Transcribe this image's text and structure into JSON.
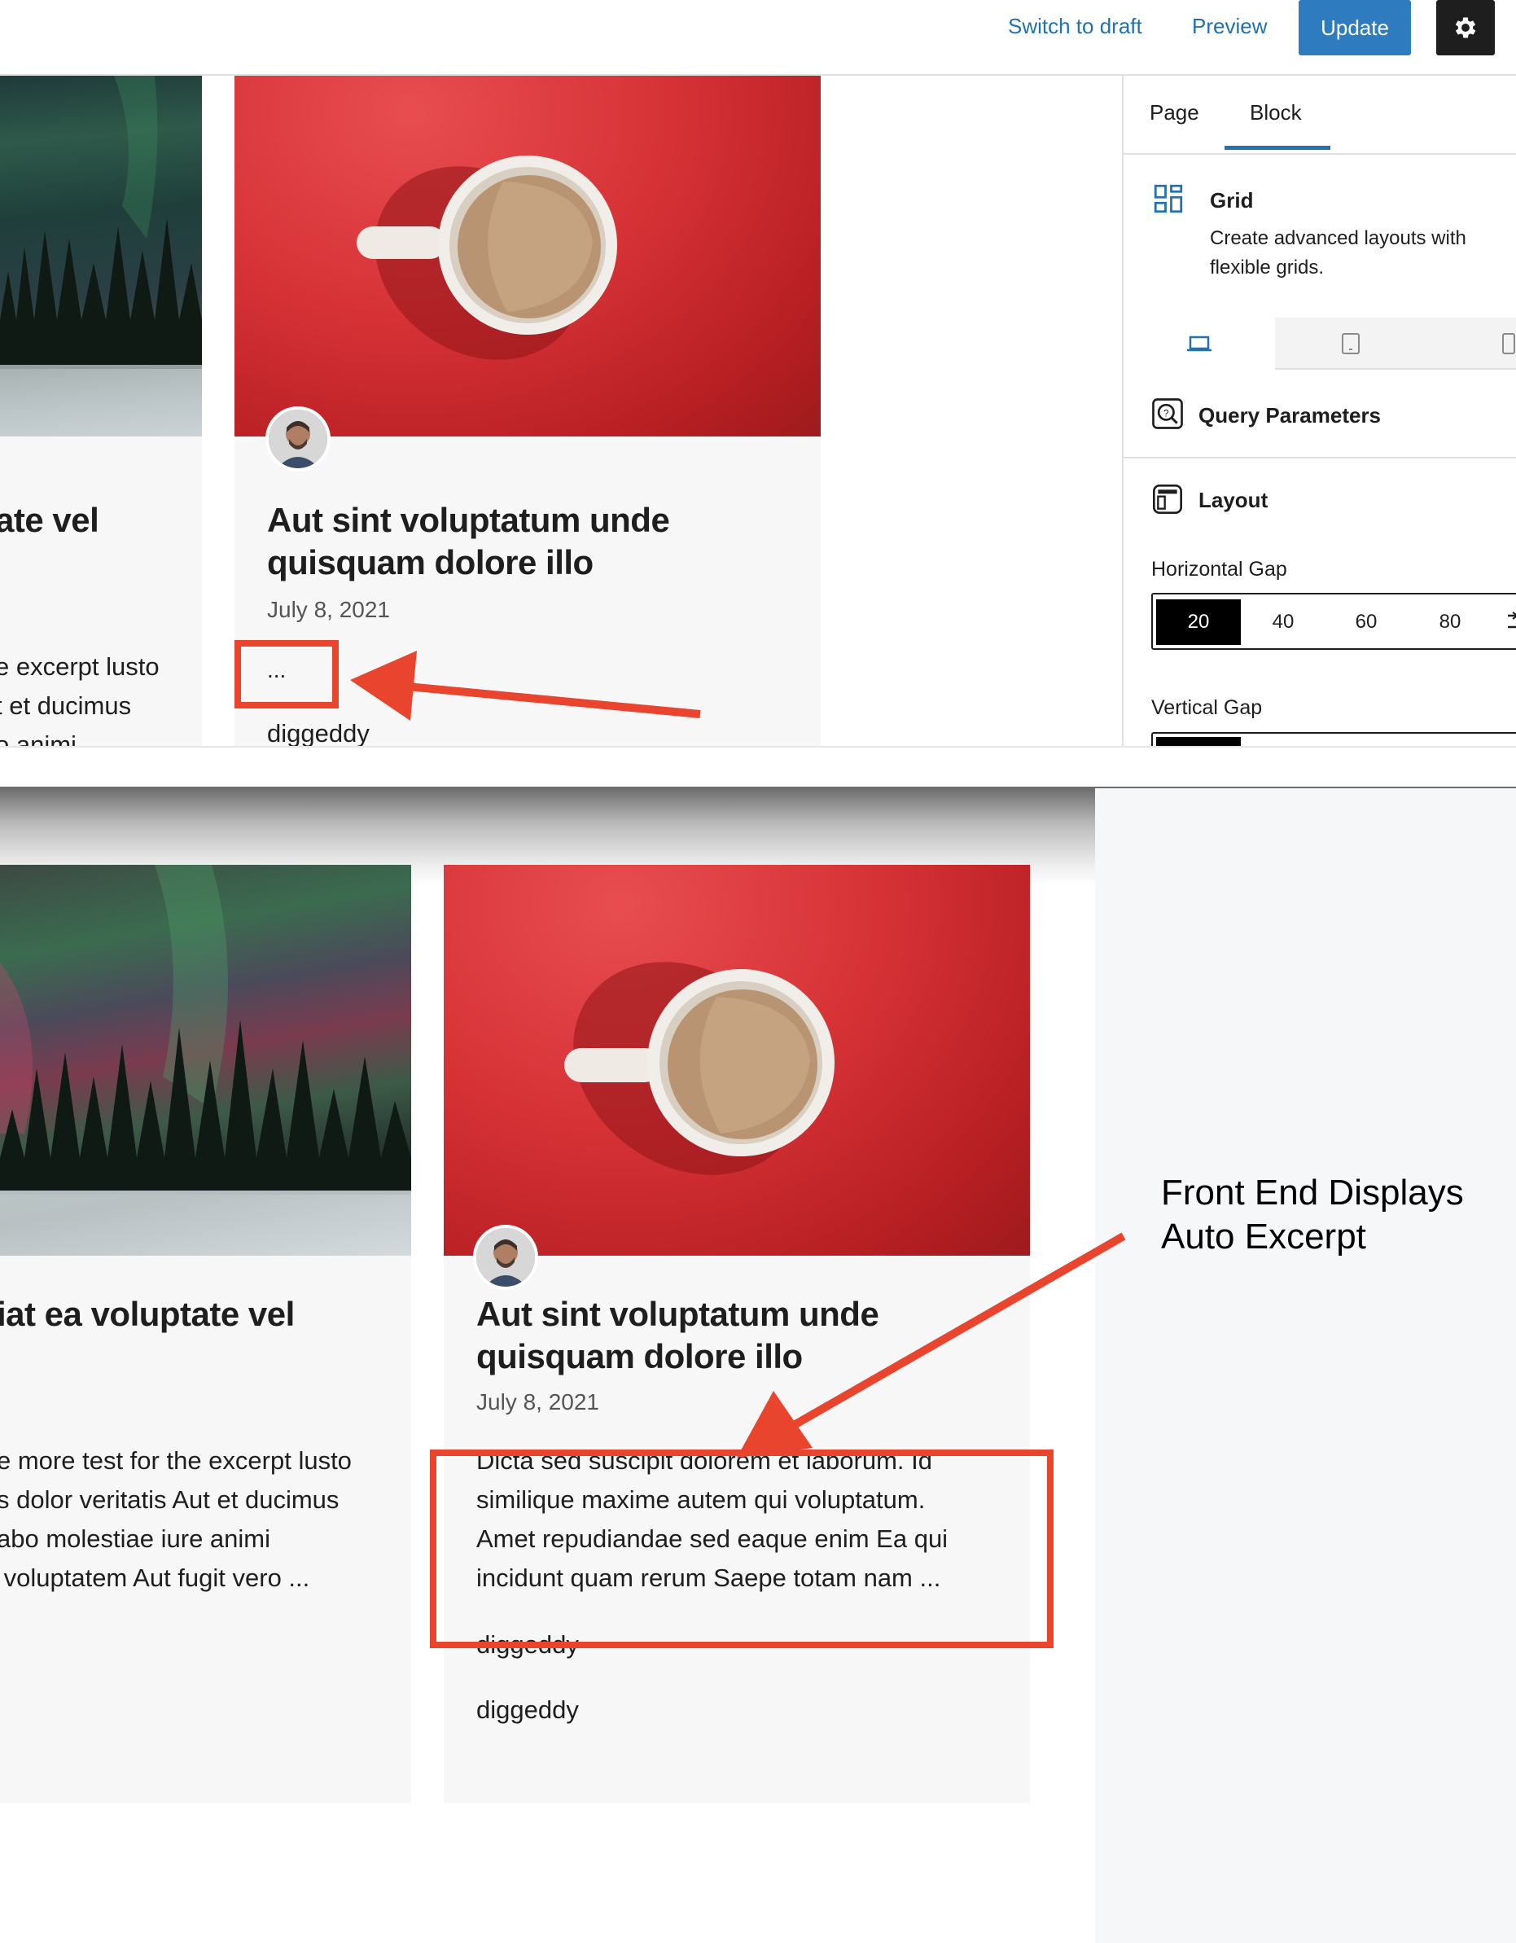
{
  "editor": {
    "topbar": {
      "switch_to_draft": "Switch to draft",
      "preview": "Preview",
      "update": "Update"
    },
    "canvas": {
      "left_card": {
        "title_fragment": "ate vel",
        "excerpt_lines": [
          "e excerpt lusto",
          "t et ducimus",
          "o animi"
        ]
      },
      "right_card": {
        "title": "Aut sint voluptatum unde quisquam dolore illo",
        "date": "July 8, 2021",
        "excerpt": "...",
        "author": "diggeddy"
      }
    },
    "sidebar": {
      "tabs": [
        "Page",
        "Block"
      ],
      "active_tab": "Block",
      "block": {
        "name": "Grid",
        "description": "Create advanced layouts with flexible grids."
      },
      "panels": {
        "query_parameters": "Query Parameters",
        "layout": "Layout"
      },
      "horizontal_gap": {
        "label": "Horizontal Gap",
        "options": [
          "20",
          "40",
          "60",
          "80"
        ],
        "selected": "20"
      },
      "vertical_gap": {
        "label": "Vertical Gap"
      }
    }
  },
  "frontend": {
    "left_card": {
      "title_fragment": "iat ea voluptate vel",
      "excerpt_lines": [
        "e more test for the excerpt lusto",
        "s dolor veritatis Aut et ducimus",
        "abo molestiae iure animi",
        " voluptatem Aut fugit vero ..."
      ]
    },
    "right_card": {
      "title": "Aut sint voluptatum unde quisquam dolore illo",
      "date": "July 8, 2021",
      "excerpt_lines": [
        "Dicta sed suscipit dolorem et laborum. Id",
        "similique maxime autem qui voluptatum.",
        "Amet repudiandae sed eaque enim Ea qui",
        "incidunt quam rerum Saepe totam nam ..."
      ],
      "author_lines": [
        "diggeddy",
        "diggeddy"
      ]
    },
    "annotation": "Front End Displays Auto Excerpt"
  },
  "colors": {
    "accent": "#2271b1",
    "update_button": "#2f7bbf",
    "annotation_red": "#e8442e",
    "card_bg": "#f7f7f7"
  },
  "icons": [
    "gear-icon",
    "grid-block-icon",
    "desktop-icon",
    "tablet-icon",
    "mobile-icon",
    "query-icon",
    "layout-icon",
    "chevron-right-icon"
  ]
}
